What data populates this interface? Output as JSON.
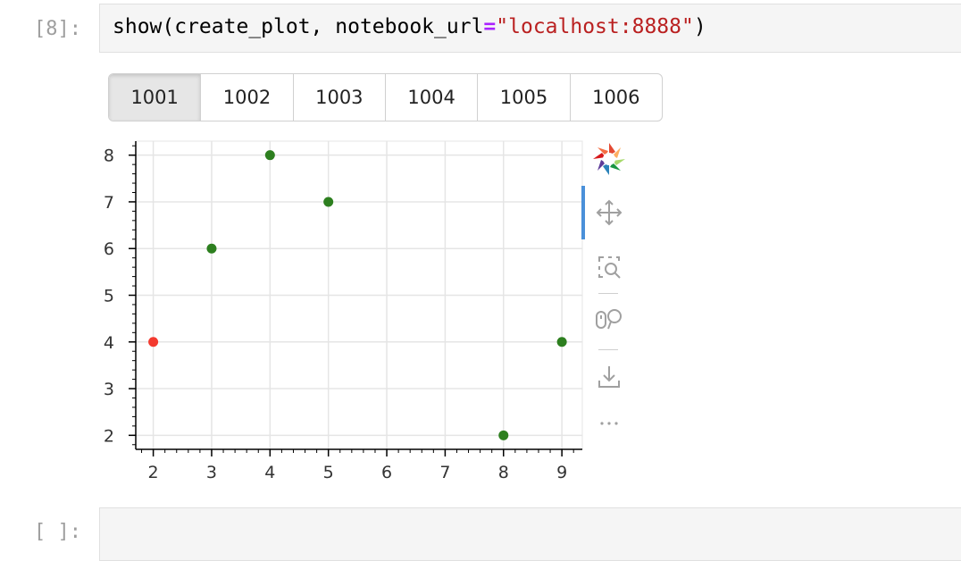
{
  "cells": [
    {
      "prompt": "[8]:",
      "code": {
        "fn": "show(create_plot, notebook_url",
        "op": "=",
        "str": "\"localhost:8888\"",
        "close": ")"
      }
    },
    {
      "prompt": "[ ]:",
      "code": ""
    }
  ],
  "tabs": {
    "labels": [
      "1001",
      "1002",
      "1003",
      "1004",
      "1005",
      "1006"
    ],
    "active": "1001"
  },
  "toolbar": {
    "tools": [
      "bokeh-logo-icon",
      "pan-icon",
      "box-zoom-icon",
      "wheel-zoom-icon",
      "save-icon",
      "more-icon"
    ],
    "active_tool": "pan-icon"
  },
  "chart_data": {
    "type": "scatter",
    "points": [
      {
        "x": 2,
        "y": 4,
        "color": "#f33a2f"
      },
      {
        "x": 3,
        "y": 6,
        "color": "#2d7f1f"
      },
      {
        "x": 4,
        "y": 8,
        "color": "#2d7f1f"
      },
      {
        "x": 5,
        "y": 7,
        "color": "#2d7f1f"
      },
      {
        "x": 8,
        "y": 2,
        "color": "#2d7f1f"
      },
      {
        "x": 9,
        "y": 4,
        "color": "#2d7f1f"
      }
    ],
    "xlim": [
      1.7,
      9.35
    ],
    "ylim": [
      1.7,
      8.3
    ],
    "xticks": [
      2,
      3,
      4,
      5,
      6,
      7,
      8,
      9
    ],
    "yticks": [
      2,
      3,
      4,
      5,
      6,
      7,
      8
    ],
    "grid": true,
    "title": "",
    "xlabel": "",
    "ylabel": ""
  }
}
